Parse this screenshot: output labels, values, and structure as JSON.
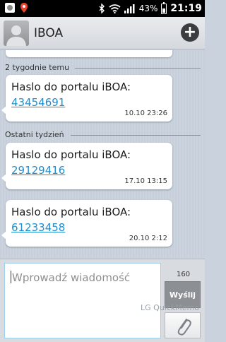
{
  "status_bar": {
    "battery": "43%",
    "battery_level": 0.43,
    "time": "21:19"
  },
  "header": {
    "contact_name": "IBOA",
    "add_icon": "plus-icon"
  },
  "dividers": {
    "two_weeks": "2 tygodnie temu",
    "last_week": "Ostatni tydzień"
  },
  "messages": [
    {
      "text": "Haslo do portalu iBOA:",
      "code": "43454691",
      "time": "10.10 23:26"
    },
    {
      "text": "Haslo do portalu iBOA:",
      "code": "29129416",
      "time": "17.10 13:15"
    },
    {
      "text": "Haslo do portalu iBOA:",
      "code": "61233458",
      "time": "20.10 2:12"
    }
  ],
  "compose": {
    "placeholder": "Wprowadź wiadomość",
    "char_counter": "160",
    "send_label": "Wyślij"
  },
  "watermark": "LG QuickMemo",
  "colors": {
    "link": "#1f8fcf",
    "status_bar": "#000000",
    "background": "#c9d2dd"
  }
}
